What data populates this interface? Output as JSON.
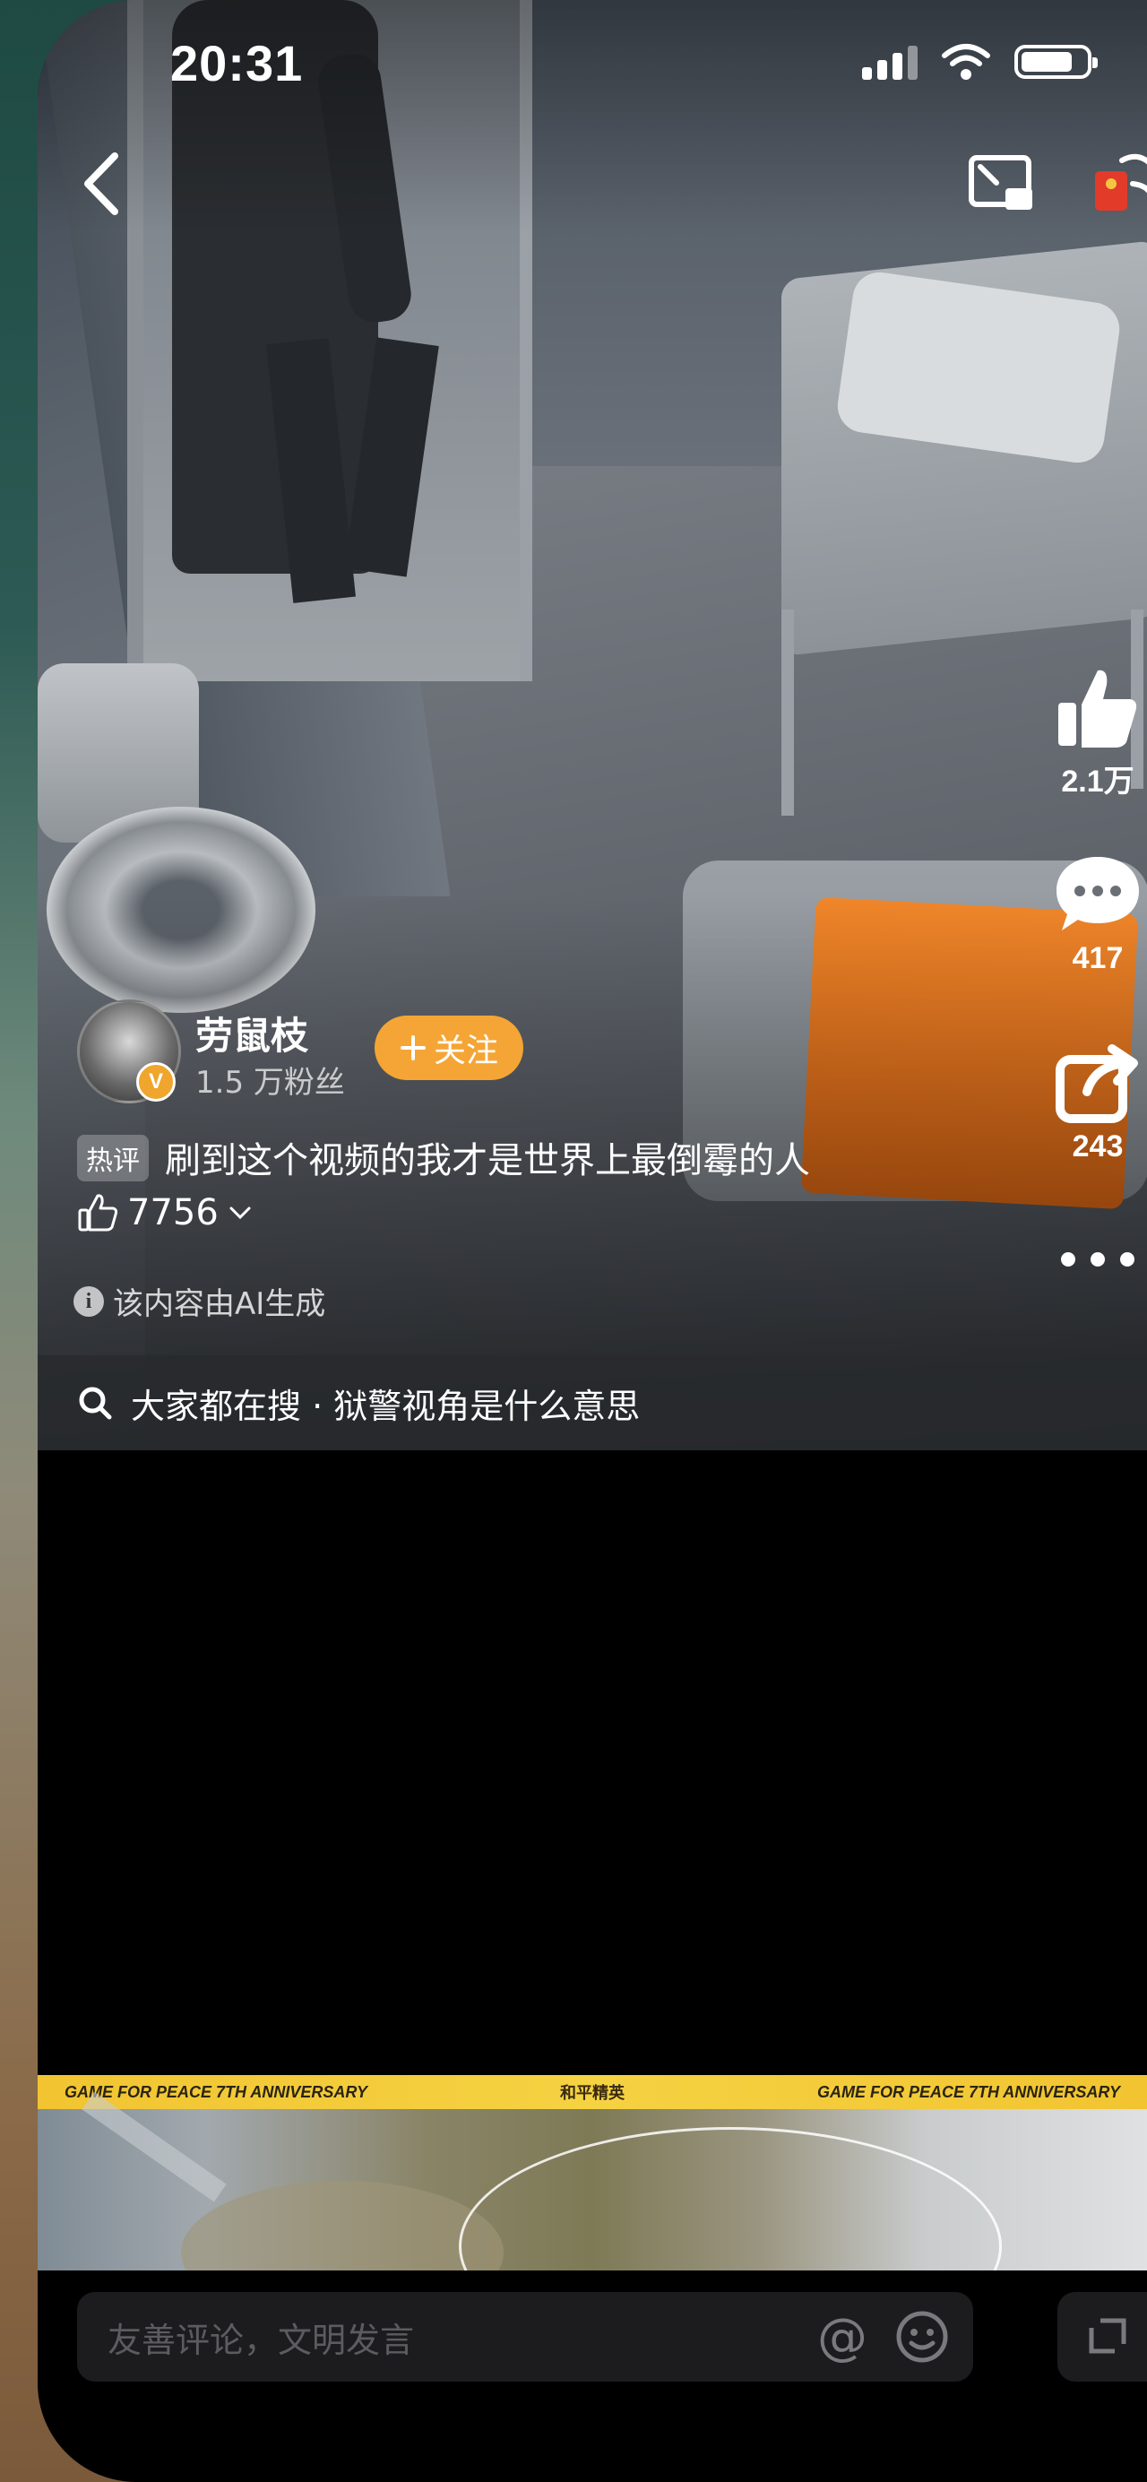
{
  "status": {
    "time": "20:31"
  },
  "actions": {
    "likes": "2.1万",
    "comments": "417",
    "shares": "243"
  },
  "author": {
    "name": "劳鼠枝",
    "fans": "1.5 万粉丝",
    "verified_badge": "V",
    "follow_label": "关注"
  },
  "hot_comment": {
    "tag": "热评",
    "text": "刷到这个视频的我才是世界上最倒霉的人",
    "likes": "7756"
  },
  "ai_notice": {
    "icon_letter": "i",
    "text": "该内容由AI生成"
  },
  "search": {
    "text": "大家都在搜 · 狱警视角是什么意思"
  },
  "banner": {
    "left_text": "GAME FOR PEACE 7TH ANNIVERSARY",
    "center_text": "和平精英",
    "right_text": "GAME FOR PEACE 7TH ANNIVERSARY"
  },
  "comment_input": {
    "placeholder": "友善评论，文明发言"
  },
  "colors": {
    "accent": "#f5a535",
    "background": "#000000"
  }
}
